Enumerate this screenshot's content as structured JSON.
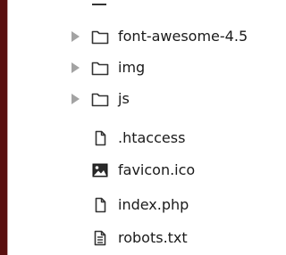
{
  "file_tree": {
    "items": [
      {
        "label": "font-awesome-4.5",
        "type": "folder",
        "icon": "folder-icon"
      },
      {
        "label": "img",
        "type": "folder",
        "icon": "folder-icon"
      },
      {
        "label": "js",
        "type": "folder",
        "icon": "folder-icon"
      },
      {
        "label": ".htaccess",
        "type": "file",
        "icon": "file-icon"
      },
      {
        "label": "favicon.ico",
        "type": "image",
        "icon": "image-file-icon"
      },
      {
        "label": "index.php",
        "type": "file",
        "icon": "file-icon"
      },
      {
        "label": "robots.txt",
        "type": "text",
        "icon": "text-file-icon"
      }
    ]
  },
  "colors": {
    "window_edge": "#5a1010",
    "twisty": "#a3a3a3",
    "text": "#1a1a1a"
  }
}
